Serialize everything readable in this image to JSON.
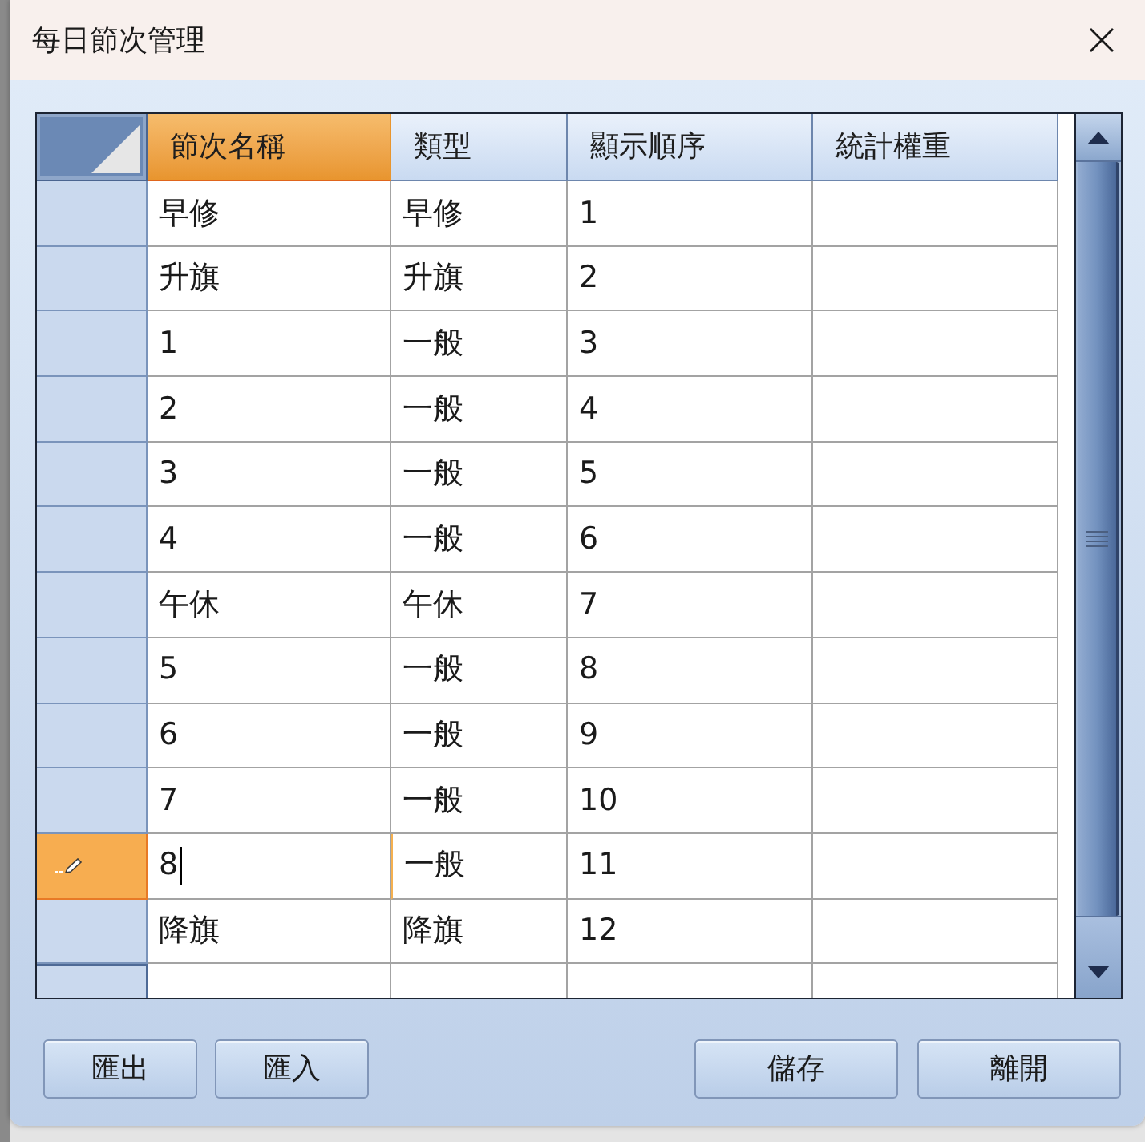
{
  "window": {
    "title": "每日節次管理"
  },
  "grid": {
    "columns": [
      {
        "label": "節次名稱",
        "selected": true
      },
      {
        "label": "類型",
        "selected": false
      },
      {
        "label": "顯示順序",
        "selected": false
      },
      {
        "label": "統計權重",
        "selected": false
      }
    ],
    "rows": [
      {
        "name": "早修",
        "type": "早修",
        "order": "1",
        "selected": false
      },
      {
        "name": "升旗",
        "type": "升旗",
        "order": "2",
        "selected": false
      },
      {
        "name": "1",
        "type": "一般",
        "order": "3",
        "selected": false
      },
      {
        "name": "2",
        "type": "一般",
        "order": "4",
        "selected": false
      },
      {
        "name": "3",
        "type": "一般",
        "order": "5",
        "selected": false
      },
      {
        "name": "4",
        "type": "一般",
        "order": "6",
        "selected": false
      },
      {
        "name": "午休",
        "type": "午休",
        "order": "7",
        "selected": false
      },
      {
        "name": "5",
        "type": "一般",
        "order": "8",
        "selected": false
      },
      {
        "name": "6",
        "type": "一般",
        "order": "9",
        "selected": false
      },
      {
        "name": "7",
        "type": "一般",
        "order": "10",
        "selected": false
      },
      {
        "name": "8",
        "type": "一般",
        "order": "11",
        "selected": true
      },
      {
        "name": "降旗",
        "type": "降旗",
        "order": "12",
        "selected": false
      }
    ]
  },
  "buttons": {
    "left": [
      "匯出",
      "匯入"
    ],
    "right": [
      "儲存",
      "離開"
    ]
  }
}
